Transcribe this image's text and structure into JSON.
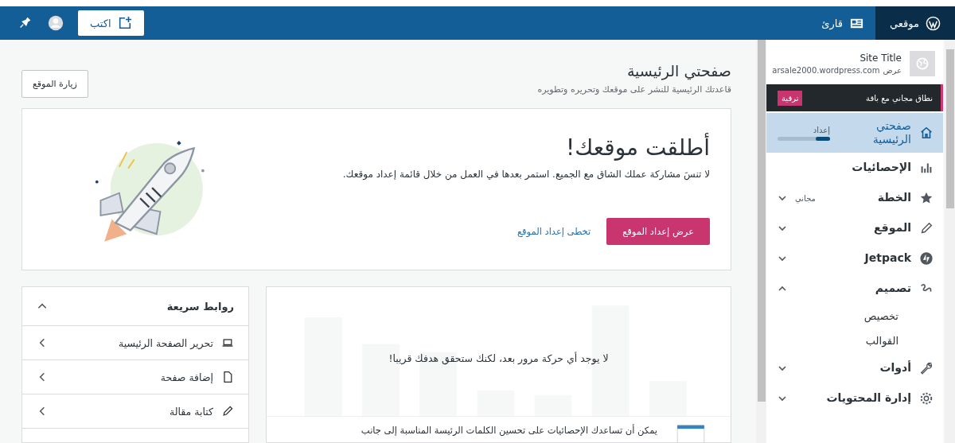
{
  "top_bar": {
    "tabs": [
      {
        "kind": "site",
        "label": "موقعي",
        "selected": true
      },
      {
        "kind": "reader",
        "label": "قارئ",
        "selected": false
      }
    ],
    "write_button": "اكتب"
  },
  "sidebar": {
    "site_title": "Site Title",
    "site_url": "arsale2000.wordpress.com",
    "site_view": "عرض",
    "upgrade": {
      "text": "نطاق مجاني مع باقة",
      "button": "ترقية"
    },
    "items": [
      {
        "kind": "home",
        "label": "صفحتي الرئيسية",
        "selected": true,
        "badge": "إعداد",
        "level": 0.28
      },
      {
        "kind": "stats",
        "label": "الإحصائيات",
        "selected": false
      },
      {
        "kind": "star",
        "label": "الخطة",
        "selected": false,
        "badge": "مجاني",
        "expanded": false
      },
      {
        "kind": "pencil",
        "label": "الموقع",
        "selected": false,
        "expanded": false
      },
      {
        "kind": "jetpack",
        "label": "Jetpack",
        "selected": false,
        "expanded": false
      },
      {
        "kind": "brush",
        "label": "تصميم",
        "selected": false,
        "expanded": true,
        "children": [
          {
            "label": "تخصيص"
          },
          {
            "label": "القوالب"
          }
        ]
      },
      {
        "kind": "wrench",
        "label": "أدوات",
        "selected": false,
        "expanded": false
      },
      {
        "kind": "gear",
        "label": "إدارة المحتويات",
        "selected": false,
        "expanded": false
      }
    ]
  },
  "header": {
    "title": "صفحتي الرئيسية",
    "subtitle": "قاعدتك الرئيسية للنشر على موقعك وتحريره وتطويره",
    "visit_button": "زيارة الموقع"
  },
  "banner": {
    "title": "أطلقت موقعك!",
    "text": "لا تنسَ مشاركة عملك الشاق مع الجميع. استمر بعدها في العمل من خلال قائمة إعداد موقعك.",
    "primary_button": "عرض إعداد الموقع",
    "link": "تخطى إعداد الموقع"
  },
  "quick_links": {
    "title": "روابط سريعة",
    "expanded": true,
    "items": [
      {
        "kind": "laptop",
        "label": "تحرير الصفحة الرئيسية"
      },
      {
        "kind": "page",
        "label": "إضافة صفحة"
      },
      {
        "kind": "pencil",
        "label": "كتابة مقالة"
      }
    ]
  },
  "stats_card": {
    "message": "لا يوجد أي حركة مرور بعد، لكنك ستحقق هدفك قريبا!",
    "tip": "يمكن أن تساعدك الإحصائيات على تحسين الكلمات الرئيسة المناسبة إلى جانب"
  }
}
